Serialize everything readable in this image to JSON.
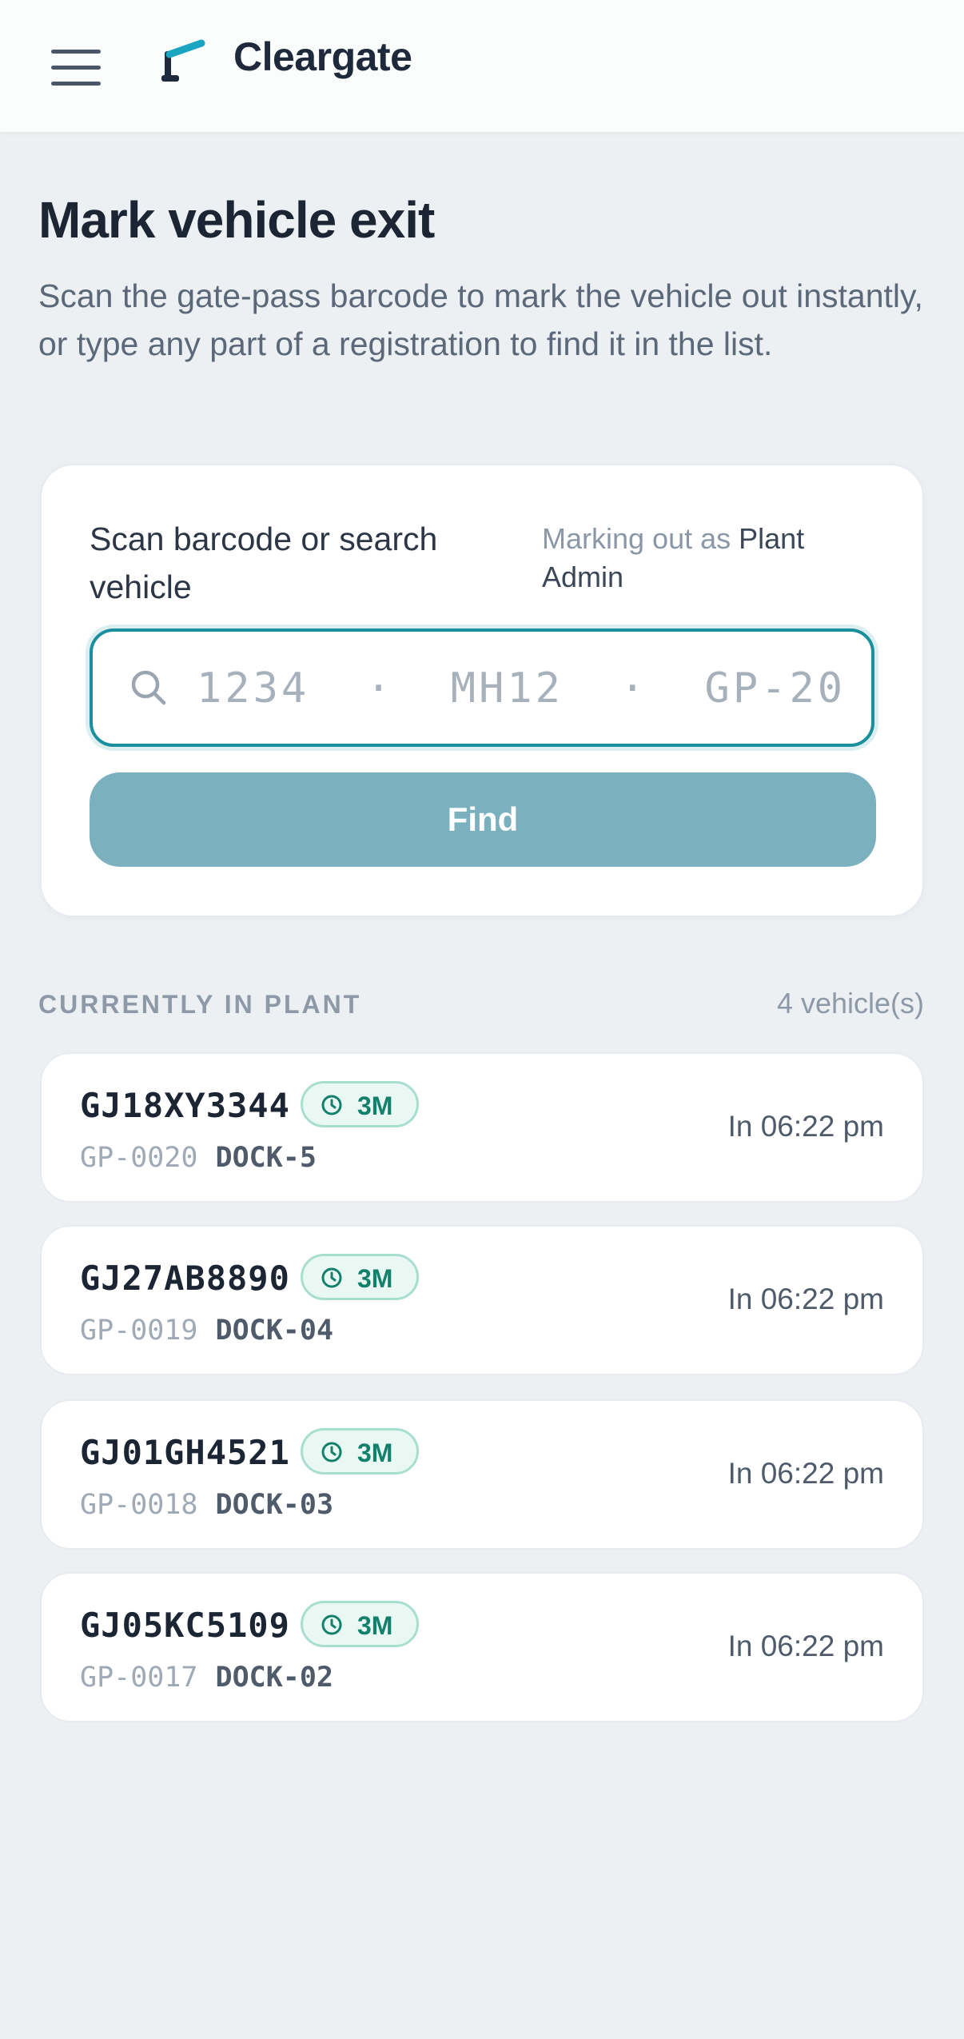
{
  "app": {
    "brand": "Cleargate"
  },
  "page": {
    "title": "Mark vehicle exit",
    "description": "Scan the gate-pass barcode to mark the vehicle out instantly, or type any part of a registration to find it in the list."
  },
  "scan_card": {
    "label": "Scan barcode or search vehicle",
    "marking_prefix": "Marking out as",
    "marking_user": "Plant Admin",
    "search_value": "",
    "search_placeholder": "1234  ·  MH12  ·  GP-20",
    "find_label": "Find"
  },
  "section": {
    "label": "CURRENTLY IN PLANT",
    "count": "4 vehicle(s)"
  },
  "vehicles": [
    {
      "plate": "GJ18XY3344",
      "badge": "3M",
      "gatepass": "GP-0020",
      "dock": "DOCK-5",
      "in_time": "In 06:22 pm"
    },
    {
      "plate": "GJ27AB8890",
      "badge": "3M",
      "gatepass": "GP-0019",
      "dock": "DOCK-04",
      "in_time": "In 06:22 pm"
    },
    {
      "plate": "GJ01GH4521",
      "badge": "3M",
      "gatepass": "GP-0018",
      "dock": "DOCK-03",
      "in_time": "In 06:22 pm"
    },
    {
      "plate": "GJ05KC5109",
      "badge": "3M",
      "gatepass": "GP-0017",
      "dock": "DOCK-02",
      "in_time": "In 06:22 pm"
    }
  ],
  "icons": {
    "menu": "hamburger-icon",
    "logo": "cleargate-logo-icon",
    "search": "search-icon",
    "badge": "clock-icon"
  },
  "colors": {
    "accent": "#1a8f9e",
    "button": "#7bb0bf",
    "badge_text": "#12806a",
    "badge_bg": "#eaf8f3",
    "background": "#edf0f3"
  }
}
